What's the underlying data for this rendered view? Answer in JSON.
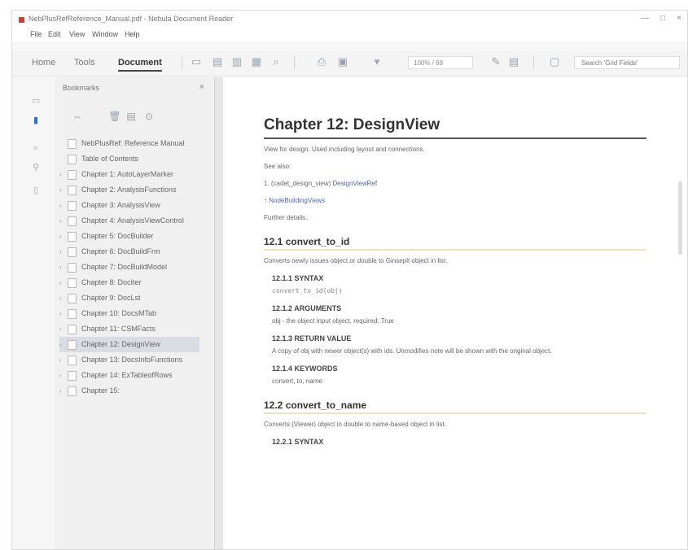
{
  "window": {
    "title": "NebPlusRefReference_Manual.pdf - Nebula Document Reader",
    "controls": {
      "minimize": "—",
      "maximize": "□",
      "close": "×"
    }
  },
  "menu": [
    "File",
    "Edit",
    "View",
    "Window",
    "Help"
  ],
  "toolbar": {
    "tabs": [
      "Home",
      "Tools",
      "Document"
    ],
    "active_tab": "Document",
    "zoom": "100% / 68",
    "search_placeholder": "Search 'Grid Fields'"
  },
  "sidepanel": {
    "title": "Bookmarks",
    "close": "×",
    "items": [
      {
        "label": "NebPlusRef: Reference Manual",
        "expander": "",
        "selected": false
      },
      {
        "label": "Table of Contents",
        "expander": "",
        "selected": false
      },
      {
        "label": "Chapter 1: AutoLayerMarker",
        "expander": "›",
        "selected": false
      },
      {
        "label": "Chapter 2: AnalysisFunctions",
        "expander": "›",
        "selected": false
      },
      {
        "label": "Chapter 3: AnalysisView",
        "expander": "›",
        "selected": false
      },
      {
        "label": "Chapter 4: AnalysisViewControl",
        "expander": "›",
        "selected": false
      },
      {
        "label": "Chapter 5: DocBuilder",
        "expander": "›",
        "selected": false
      },
      {
        "label": "Chapter 6: DocBuildFrm",
        "expander": "›",
        "selected": false
      },
      {
        "label": "Chapter 7: DocBuildModel",
        "expander": "›",
        "selected": false
      },
      {
        "label": "Chapter 8: DocIter",
        "expander": "›",
        "selected": false
      },
      {
        "label": "Chapter 9: DocLst",
        "expander": "›",
        "selected": false
      },
      {
        "label": "Chapter 10: DocsMTab",
        "expander": "›",
        "selected": false
      },
      {
        "label": "Chapter 11: CSMFacts",
        "expander": "›",
        "selected": false
      },
      {
        "label": "Chapter 12: DesignView",
        "expander": "›",
        "selected": true
      },
      {
        "label": "Chapter 13: DocsInfoFunctions",
        "expander": "›",
        "selected": false
      },
      {
        "label": "Chapter 14: ExTableofRows",
        "expander": "›",
        "selected": false
      },
      {
        "label": "Chapter 15:",
        "expander": "›",
        "selected": false
      }
    ]
  },
  "document": {
    "chapter_title": "Chapter 12: DesignView",
    "intro": "View for design. Used including layout and connections.",
    "see_also_label": "See also:",
    "link1_prefix": "1. (cadet_design_view) ",
    "link1": "DesignViewRef",
    "link2": "NodeBuildingViews",
    "see_more": "Further details.",
    "sections": [
      {
        "title": "12.1 convert_to_id",
        "desc": "Converts newly issues object or double to Ginseplt object in list.",
        "subsections": [
          {
            "title": "12.1.1 SYNTAX",
            "text": "convert_to_id(obj)",
            "code": true
          },
          {
            "title": "12.1.2 ARGUMENTS",
            "text": "obj - the object input object, required: True",
            "code": false
          },
          {
            "title": "12.1.3 RETURN VALUE",
            "text": "A copy of obj with newer object(s) with ids. Unmodifies note will be shown with the original object.",
            "code": false
          },
          {
            "title": "12.1.4 KEYWORDS",
            "text": "convert, to, name",
            "code": false
          }
        ]
      },
      {
        "title": "12.2 convert_to_name",
        "desc": "Converts (Viewer) object in double to name-based object in list.",
        "subsections": [
          {
            "title": "12.2.1 SYNTAX",
            "text": "",
            "code": false
          }
        ]
      }
    ]
  }
}
